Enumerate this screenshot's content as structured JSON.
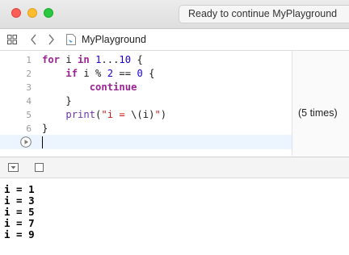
{
  "window": {
    "status": "Ready to continue MyPlayground"
  },
  "jumpbar": {
    "file_name": "MyPlayground"
  },
  "editor": {
    "lines": [
      {
        "number": "1",
        "tokens": [
          [
            "kw",
            "for"
          ],
          [
            "t",
            " i "
          ],
          [
            "kw",
            "in"
          ],
          [
            "t",
            " "
          ],
          [
            "num",
            "1"
          ],
          [
            "t",
            "..."
          ],
          [
            "num",
            "10"
          ],
          [
            "t",
            " {"
          ]
        ]
      },
      {
        "number": "2",
        "tokens": [
          [
            "t",
            "    "
          ],
          [
            "kw",
            "if"
          ],
          [
            "t",
            " i % "
          ],
          [
            "num",
            "2"
          ],
          [
            "t",
            " == "
          ],
          [
            "num",
            "0"
          ],
          [
            "t",
            " {"
          ]
        ]
      },
      {
        "number": "3",
        "tokens": [
          [
            "t",
            "        "
          ],
          [
            "kw",
            "continue"
          ]
        ]
      },
      {
        "number": "4",
        "tokens": [
          [
            "t",
            "    }"
          ]
        ]
      },
      {
        "number": "5",
        "tokens": [
          [
            "t",
            "    "
          ],
          [
            "fn",
            "print"
          ],
          [
            "t",
            "("
          ],
          [
            "str",
            "\"i = "
          ],
          [
            "t",
            "\\(i)"
          ],
          [
            "str",
            "\""
          ],
          [
            "t",
            ")"
          ]
        ]
      },
      {
        "number": "6",
        "tokens": [
          [
            "t",
            "}"
          ]
        ]
      }
    ],
    "result": "(5 times)"
  },
  "console": {
    "lines": [
      "i = 1",
      "i = 3",
      "i = 5",
      "i = 7",
      "i = 9"
    ]
  },
  "colors": {
    "keyword": "#9b2393",
    "number": "#1c00cf",
    "string": "#c41a16",
    "function": "#6c36a9",
    "close": "#fd5f57",
    "minimize": "#fdbc2e",
    "maximize": "#28c840"
  }
}
